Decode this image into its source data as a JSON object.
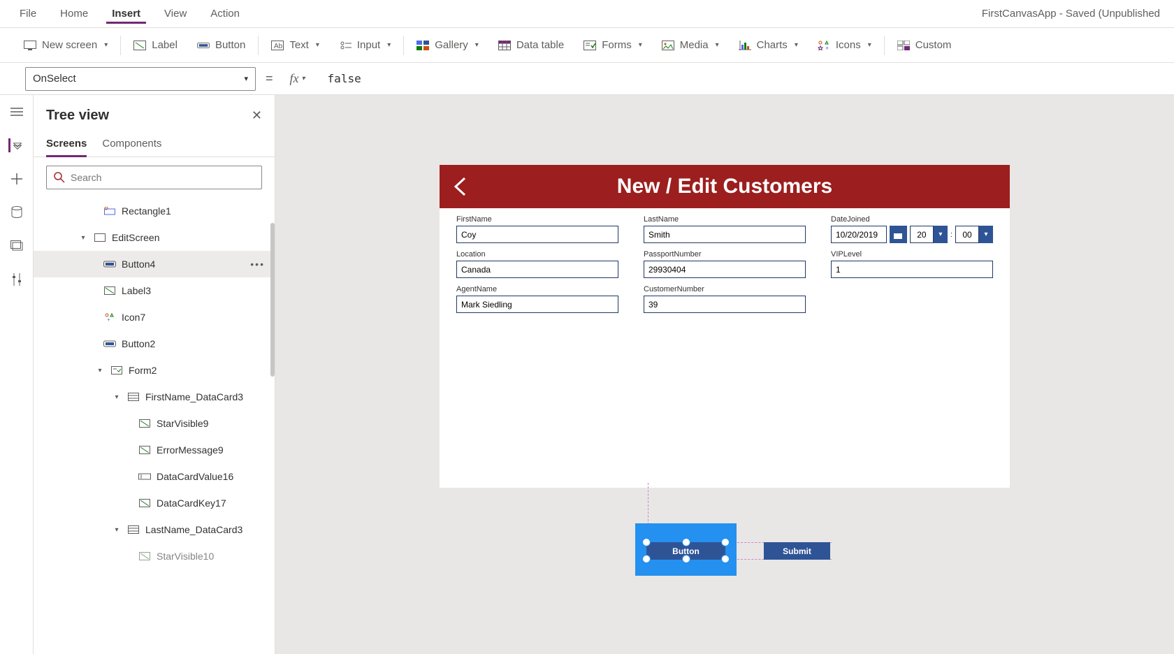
{
  "menubar": {
    "items": [
      "File",
      "Home",
      "Insert",
      "View",
      "Action"
    ],
    "active": "Insert",
    "title": "FirstCanvasApp - Saved (Unpublished"
  },
  "toolbar": {
    "newscreen": "New screen",
    "label": "Label",
    "button": "Button",
    "text": "Text",
    "input": "Input",
    "gallery": "Gallery",
    "datatable": "Data table",
    "forms": "Forms",
    "media": "Media",
    "charts": "Charts",
    "icons": "Icons",
    "custom": "Custom"
  },
  "formulabar": {
    "property": "OnSelect",
    "value": "false"
  },
  "treepanel": {
    "title": "Tree view",
    "tabs": {
      "screens": "Screens",
      "components": "Components"
    },
    "search_placeholder": "Search",
    "nodes": {
      "rectangle1": "Rectangle1",
      "editscreen": "EditScreen",
      "button4": "Button4",
      "label3": "Label3",
      "icon7": "Icon7",
      "button2": "Button2",
      "form2": "Form2",
      "firstnamedc": "FirstName_DataCard3",
      "starvisible9": "StarVisible9",
      "errormessage9": "ErrorMessage9",
      "datacardvalue16": "DataCardValue16",
      "datacardkey17": "DataCardKey17",
      "lastnamedc": "LastName_DataCard3",
      "starvisible10": "StarVisible10"
    }
  },
  "app": {
    "header": "New / Edit Customers",
    "fields": {
      "firstname": {
        "label": "FirstName",
        "value": "Coy"
      },
      "lastname": {
        "label": "LastName",
        "value": "Smith"
      },
      "datejoined": {
        "label": "DateJoined",
        "value": "10/20/2019",
        "hour": "20",
        "minute": "00"
      },
      "location": {
        "label": "Location",
        "value": "Canada"
      },
      "passport": {
        "label": "PassportNumber",
        "value": "29930404"
      },
      "viplevel": {
        "label": "VIPLevel",
        "value": "1"
      },
      "agent": {
        "label": "AgentName",
        "value": "Mark Siedling"
      },
      "custnum": {
        "label": "CustomerNumber",
        "value": "39"
      }
    },
    "buttons": {
      "new": "Button",
      "submit": "Submit"
    }
  }
}
